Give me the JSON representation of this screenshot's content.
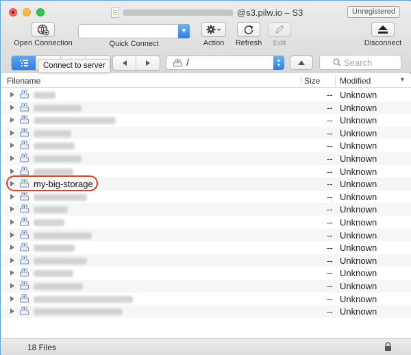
{
  "window": {
    "title_suffix": "@s3.pilw.io – S3",
    "registration_badge": "Unregistered"
  },
  "toolbar": {
    "open_connection": "Open Connection",
    "quick_connect": "Quick Connect",
    "action": "Action",
    "refresh": "Refresh",
    "edit": "Edit",
    "disconnect": "Disconnect"
  },
  "nav": {
    "tooltip": "Connect to server",
    "path": "/",
    "search_placeholder": "Search"
  },
  "table": {
    "columns": {
      "filename": "Filename",
      "size": "Size",
      "modified": "Modified"
    },
    "rows": [
      {
        "name": "",
        "size": "--",
        "modified": "Unknown"
      },
      {
        "name": "",
        "size": "--",
        "modified": "Unknown"
      },
      {
        "name": "",
        "size": "--",
        "modified": "Unknown"
      },
      {
        "name": "",
        "size": "--",
        "modified": "Unknown"
      },
      {
        "name": "",
        "size": "--",
        "modified": "Unknown"
      },
      {
        "name": "",
        "size": "--",
        "modified": "Unknown"
      },
      {
        "name": "",
        "size": "--",
        "modified": "Unknown"
      },
      {
        "name": "my-big-storage",
        "size": "--",
        "modified": "Unknown"
      },
      {
        "name": "",
        "size": "--",
        "modified": "Unknown"
      },
      {
        "name": "",
        "size": "--",
        "modified": "Unknown"
      },
      {
        "name": "",
        "size": "--",
        "modified": "Unknown"
      },
      {
        "name": "",
        "size": "--",
        "modified": "Unknown"
      },
      {
        "name": "",
        "size": "--",
        "modified": "Unknown"
      },
      {
        "name": "",
        "size": "--",
        "modified": "Unknown"
      },
      {
        "name": "",
        "size": "--",
        "modified": "Unknown"
      },
      {
        "name": "",
        "size": "--",
        "modified": "Unknown"
      },
      {
        "name": "",
        "size": "--",
        "modified": "Unknown"
      },
      {
        "name": "",
        "size": "--",
        "modified": "Unknown"
      }
    ]
  },
  "footer": {
    "file_count": "18 Files"
  },
  "colors": {
    "accent": "#2a7fe8",
    "highlight_ring": "#ea3a1c"
  }
}
